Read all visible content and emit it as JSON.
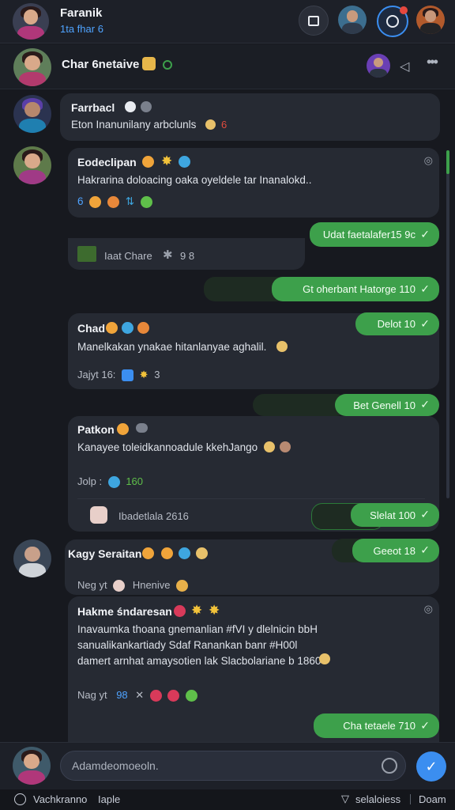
{
  "topbar": {
    "title": "Faranik",
    "subtitle": "1ta fhar 6"
  },
  "chat_header": {
    "title": "Char 6netaive"
  },
  "messages": [
    {
      "name": "Farrbacl",
      "text": "Eton Inanunilany arbclunls"
    },
    {
      "name": "Eodeclipan",
      "text": "Hakrarina doloacing oaka oyeldele tar Inanalokd..",
      "react": "6"
    },
    {
      "name": "Chad",
      "text": "Manelkakan ynakae hitanlanyae aghalil.",
      "react": "Jajyt  16:",
      "react_count": "3"
    },
    {
      "name": "Patkon",
      "text": "Kanayee toleidkannoadule kkehJango",
      "react": "Jolp :",
      "react_count": "160"
    },
    {
      "name": "Kagy Seraitan",
      "react": "Neg yt",
      "react_word": "Hnenive"
    },
    {
      "name": "Hakme śndaresan",
      "lines": [
        "Inavaumka thoana gnemanlian #fVI y dlelnicin bbH",
        "sanualikankartiady Sdaf Ranankan banr #H00l",
        "damert arnhat amaysotien lak Slacbolariane b 1860"
      ],
      "react": "Nag yt",
      "react_count": "98"
    }
  ],
  "attachment": {
    "label": "Iaat Chare",
    "count": "9 8"
  },
  "attachment2": {
    "label": "Ibadetlala 2616"
  },
  "outgoing": [
    {
      "text": "Udat faetalafer15 9c"
    },
    {
      "text": "Gt oherbant Hatorge 110"
    },
    {
      "text": "Delot 10"
    },
    {
      "text": "Bet Genell 10"
    },
    {
      "text": "Slelat 100"
    },
    {
      "text": "Geeot 18"
    },
    {
      "text": "Cha tetaele 710"
    }
  ],
  "composer": {
    "placeholder": "Adamdeomoeoln."
  },
  "footer": {
    "left": "Vachkranno",
    "mid": "Iaple",
    "right": "selaloiess",
    "right2": "Doam"
  }
}
